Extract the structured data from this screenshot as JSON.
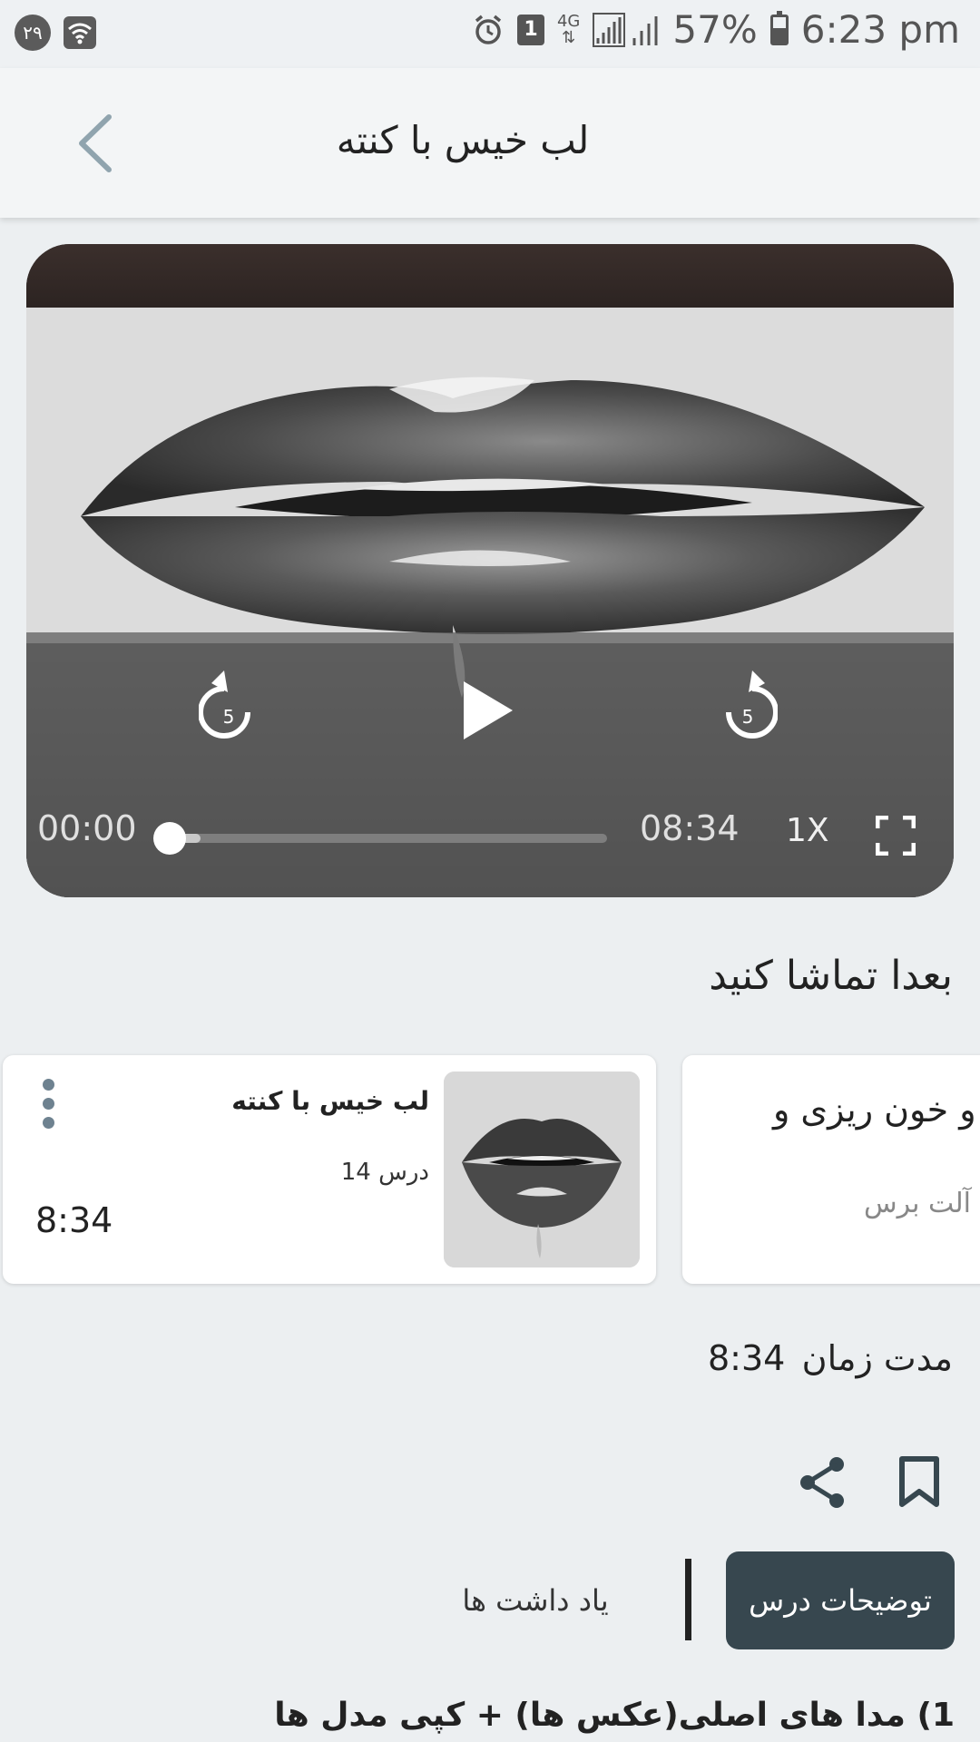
{
  "status_bar": {
    "left_badge": "۲۹",
    "sim_label": "1",
    "network": "4G",
    "battery": "57%",
    "time": "6:23 pm"
  },
  "app_bar": {
    "title": "لب خیس با کنته",
    "back_icon": "chevron-left-icon"
  },
  "player": {
    "current_time": "00:00",
    "total_time": "08:34",
    "speed": "1X",
    "progress": 0.0,
    "rewind_seconds": "5",
    "forward_seconds": "5"
  },
  "watch_later": {
    "title": "بعدا تماشا کنید",
    "cards": [
      {
        "title": "لب خیس با کنته",
        "lesson": "درس 14",
        "duration": "8:34"
      },
      {
        "title": "د و خون ریزی و",
        "subtitle": "آلت برس"
      }
    ]
  },
  "duration_row": {
    "label": "مدت زمان",
    "value": "8:34"
  },
  "tabs": {
    "active": "توضیحات درس",
    "inactive": "یاد داشت ها"
  },
  "description": {
    "first_line": "1) مدا های اصلی(عکس ها) + کپی مدل ها"
  }
}
